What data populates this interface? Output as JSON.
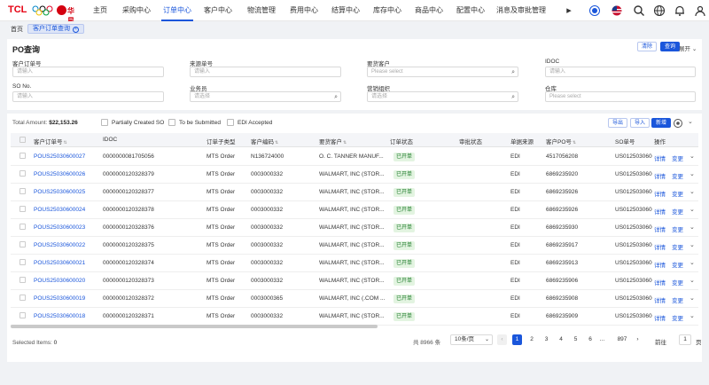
{
  "brand": {
    "logo": "TCL",
    "brand2": "华星"
  },
  "nav": {
    "items": [
      "主页",
      "采购中心",
      "订单中心",
      "客户中心",
      "物流管理",
      "费用中心",
      "结算中心",
      "库存中心",
      "商品中心",
      "配置中心",
      "消息及审批管理"
    ],
    "active_index": 2
  },
  "tabs": {
    "home": "首页",
    "current": "客户订单查询"
  },
  "query": {
    "title": "PO查询",
    "clear": "清除",
    "search": "查询",
    "expand": "展开",
    "fields": [
      {
        "label": "客户订单号",
        "placeholder": "请输入"
      },
      {
        "label": "来源单号",
        "placeholder": "请输入"
      },
      {
        "label": "要货客户",
        "placeholder": "Please select"
      },
      {
        "label": "IDOC",
        "placeholder": "请输入"
      },
      {
        "label": "SO No.",
        "placeholder": "请输入"
      },
      {
        "label": "业务员",
        "placeholder": "请选择"
      },
      {
        "label": "营销组织",
        "placeholder": "请选择"
      },
      {
        "label": "仓库",
        "placeholder": "Please select"
      }
    ]
  },
  "toolbar": {
    "total_label": "Total Amount:",
    "total_value": "$22,153.26",
    "partial": "Partially Created SO",
    "tobe": "To be Submitted",
    "edi": "EDI Accepted",
    "export": "导出",
    "import": "导入",
    "add": "新增"
  },
  "table": {
    "headers": [
      "客户订单号",
      "IDOC",
      "订单子类型",
      "客户编码",
      "要货客户",
      "订单状态",
      "审批状态",
      "单据来源",
      "客户PO号",
      "SO单号",
      "操作"
    ],
    "action_detail": "详情",
    "action_change": "变更",
    "rows": [
      [
        "POUS25030600027",
        "0000000081705056",
        "MTS Order",
        "N136724000",
        "O. C. TANNER MANUF...",
        "已开单",
        "",
        "EDI",
        "4517056208",
        "US0125030600"
      ],
      [
        "POUS25030600026",
        "0000000120328379",
        "MTS Order",
        "0003000332",
        "WALMART, INC (STOR...",
        "已开单",
        "",
        "EDI",
        "6869235920",
        "US0125030600"
      ],
      [
        "POUS25030600025",
        "0000000120328377",
        "MTS Order",
        "0003000332",
        "WALMART, INC (STOR...",
        "已开单",
        "",
        "EDI",
        "6869235926",
        "US0125030600"
      ],
      [
        "POUS25030600024",
        "0000000120328378",
        "MTS Order",
        "0003000332",
        "WALMART, INC (STOR...",
        "已开单",
        "",
        "EDI",
        "6869235926",
        "US0125030600"
      ],
      [
        "POUS25030600023",
        "0000000120328376",
        "MTS Order",
        "0003000332",
        "WALMART, INC (STOR...",
        "已开单",
        "",
        "EDI",
        "6869235930",
        "US0125030600"
      ],
      [
        "POUS25030600022",
        "0000000120328375",
        "MTS Order",
        "0003000332",
        "WALMART, INC (STOR...",
        "已开单",
        "",
        "EDI",
        "6869235917",
        "US0125030600"
      ],
      [
        "POUS25030600021",
        "0000000120328374",
        "MTS Order",
        "0003000332",
        "WALMART, INC (STOR...",
        "已开单",
        "",
        "EDI",
        "6869235913",
        "US0125030600"
      ],
      [
        "POUS25030600020",
        "0000000120328373",
        "MTS Order",
        "0003000332",
        "WALMART, INC (STOR...",
        "已开单",
        "",
        "EDI",
        "6869235906",
        "US0125030600"
      ],
      [
        "POUS25030600019",
        "0000000120328372",
        "MTS Order",
        "0003000365",
        "WALMART, INC (.COM ...",
        "已开单",
        "",
        "EDI",
        "6869235908",
        "US0125030600"
      ],
      [
        "POUS25030600018",
        "0000000120328371",
        "MTS Order",
        "0003000332",
        "WALMART, INC (STOR...",
        "已开单",
        "",
        "EDI",
        "6869235909",
        "US0125030600"
      ]
    ]
  },
  "footer": {
    "selected_label": "Selected Items:",
    "selected_value": "0",
    "total": "共 8966 条",
    "page_size": "10条/页",
    "pages": [
      "1",
      "2",
      "3",
      "4",
      "5",
      "6"
    ],
    "ellipsis": "...",
    "last": "897",
    "current_page": 1,
    "goto": "前往",
    "goto_value": "1",
    "page_unit": "页"
  }
}
